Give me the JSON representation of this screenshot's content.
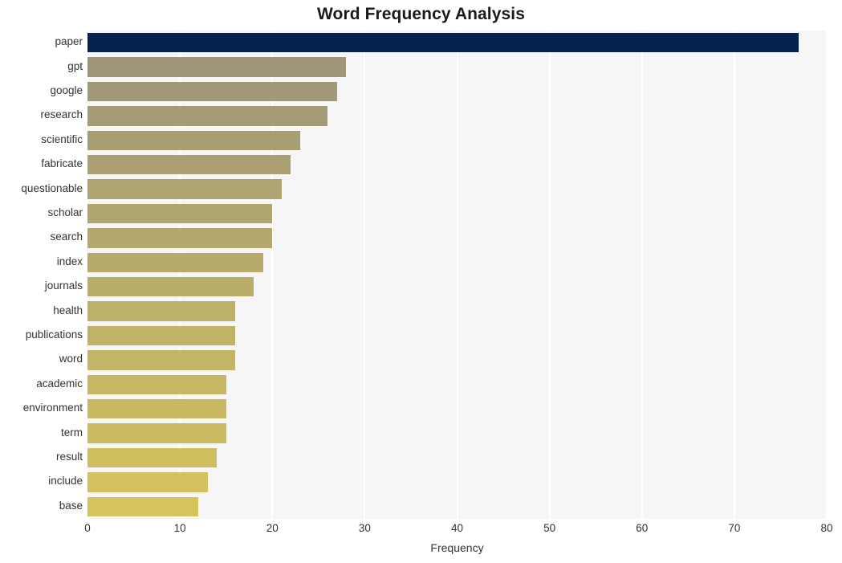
{
  "chart_data": {
    "type": "bar",
    "orientation": "horizontal",
    "title": "Word Frequency Analysis",
    "xlabel": "Frequency",
    "ylabel": "",
    "xlim": [
      0,
      80
    ],
    "xticks": [
      0,
      10,
      20,
      30,
      40,
      50,
      60,
      70,
      80
    ],
    "grid": "vertical",
    "legend": "none",
    "categories": [
      "paper",
      "gpt",
      "google",
      "research",
      "scientific",
      "fabricate",
      "questionable",
      "scholar",
      "search",
      "index",
      "journals",
      "health",
      "publications",
      "word",
      "academic",
      "environment",
      "term",
      "result",
      "include",
      "base"
    ],
    "values": [
      77,
      28,
      27,
      26,
      23,
      22,
      21,
      20,
      20,
      19,
      18,
      16,
      16,
      16,
      15,
      15,
      15,
      14,
      13,
      12
    ],
    "bar_colors": [
      "#04234f",
      "#9f9679",
      "#a29877",
      "#a49b76",
      "#ab9f6f",
      "#ad a16d",
      "#b0a46b",
      "#b3a768",
      "#b5a966",
      "#b8ac64",
      "#bbae61",
      "#bfb25d",
      "#c1b45b",
      "#c3b659",
      "#c6b857",
      "#c8ba55",
      "#cabc53",
      "#ccbe51",
      "#d0c15c",
      "#d5c45c"
    ],
    "plot_background": "#f6f6f6",
    "grid_color": "#ffffff",
    "figure_background": "#ffffff",
    "highlight_color": "#04234f",
    "highlight_category": "paper"
  }
}
